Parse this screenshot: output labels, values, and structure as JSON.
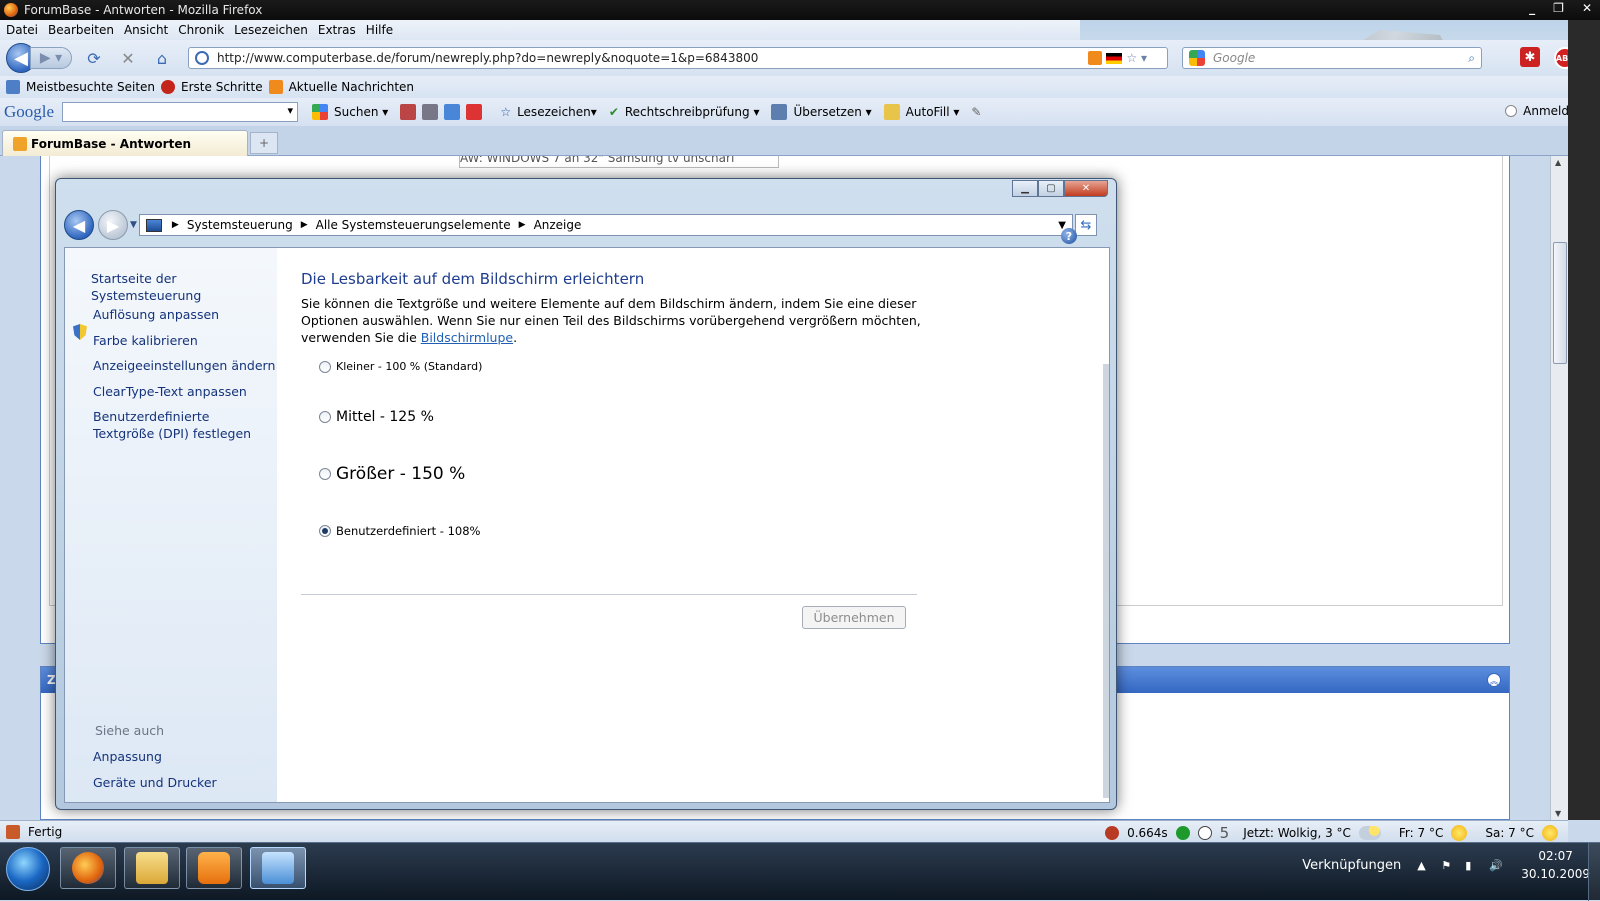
{
  "browser": {
    "title": "ForumBase - Antworten - Mozilla Firefox",
    "menu": [
      "Datei",
      "Bearbeiten",
      "Ansicht",
      "Chronik",
      "Lesezeichen",
      "Extras",
      "Hilfe"
    ],
    "url": "http://www.computerbase.de/forum/newreply.php?do=newreply&noquote=1&p=6843800",
    "search_placeholder": "Google",
    "bookmarks": [
      "Meistbesuchte Seiten",
      "Erste Schritte",
      "Aktuelle Nachrichten"
    ],
    "google_toolbar": {
      "logo": "Google",
      "search": "Suchen",
      "bookmarks": "Lesezeichen",
      "spellcheck": "Rechtschreibprüfung",
      "translate": "Übersetzen",
      "autofill": "AutoFill",
      "signin": "Anmelden"
    },
    "tab": "ForumBase - Antworten",
    "newtab": "+",
    "abp": "ABP",
    "status": "Fertig"
  },
  "forum": {
    "subject_fragment": "AW: WINDOWS 7 an 32\" Samsung tv unscharf",
    "section_letter": "Z"
  },
  "controlpanel": {
    "breadcrumb": [
      "Systemsteuerung",
      "Alle Systemsteuerungselemente",
      "Anzeige"
    ],
    "sidebar": {
      "home": "Startseite der Systemsteuerung",
      "links": [
        "Auflösung anpassen",
        "Farbe kalibrieren",
        "Anzeigeeinstellungen ändern",
        "ClearType-Text anpassen",
        "Benutzerdefinierte Textgröße (DPI) festlegen"
      ],
      "see_also": "Siehe auch",
      "see_also_links": [
        "Anpassung",
        "Geräte und Drucker"
      ]
    },
    "heading": "Die Lesbarkeit auf dem Bildschirm erleichtern",
    "description": "Sie können die Textgröße und weitere Elemente auf dem Bildschirm ändern, indem Sie eine dieser Optionen auswählen. Wenn Sie nur einen Teil des Bildschirms vorübergehend vergrößern möchten, verwenden Sie die",
    "link": "Bildschirmlupe",
    "link_suffix": ".",
    "options": [
      {
        "label": "Kleiner - 100 % (Standard)",
        "selected": false
      },
      {
        "label": "Mittel - 125 %",
        "selected": false
      },
      {
        "label": "Größer - 150 %",
        "selected": false
      },
      {
        "label": "Benutzerdefiniert - 108%",
        "selected": true
      }
    ],
    "apply": "Übernehmen"
  },
  "statusbar": {
    "timing": "0.664s",
    "count": "5",
    "weather_now": "Jetzt: Wolkig, 3 °C",
    "fri": "Fr: 7 °C",
    "sat": "Sa: 7 °C"
  },
  "taskbar": {
    "links": "Verknüpfungen",
    "time": "02:07",
    "date": "30.10.2009"
  }
}
